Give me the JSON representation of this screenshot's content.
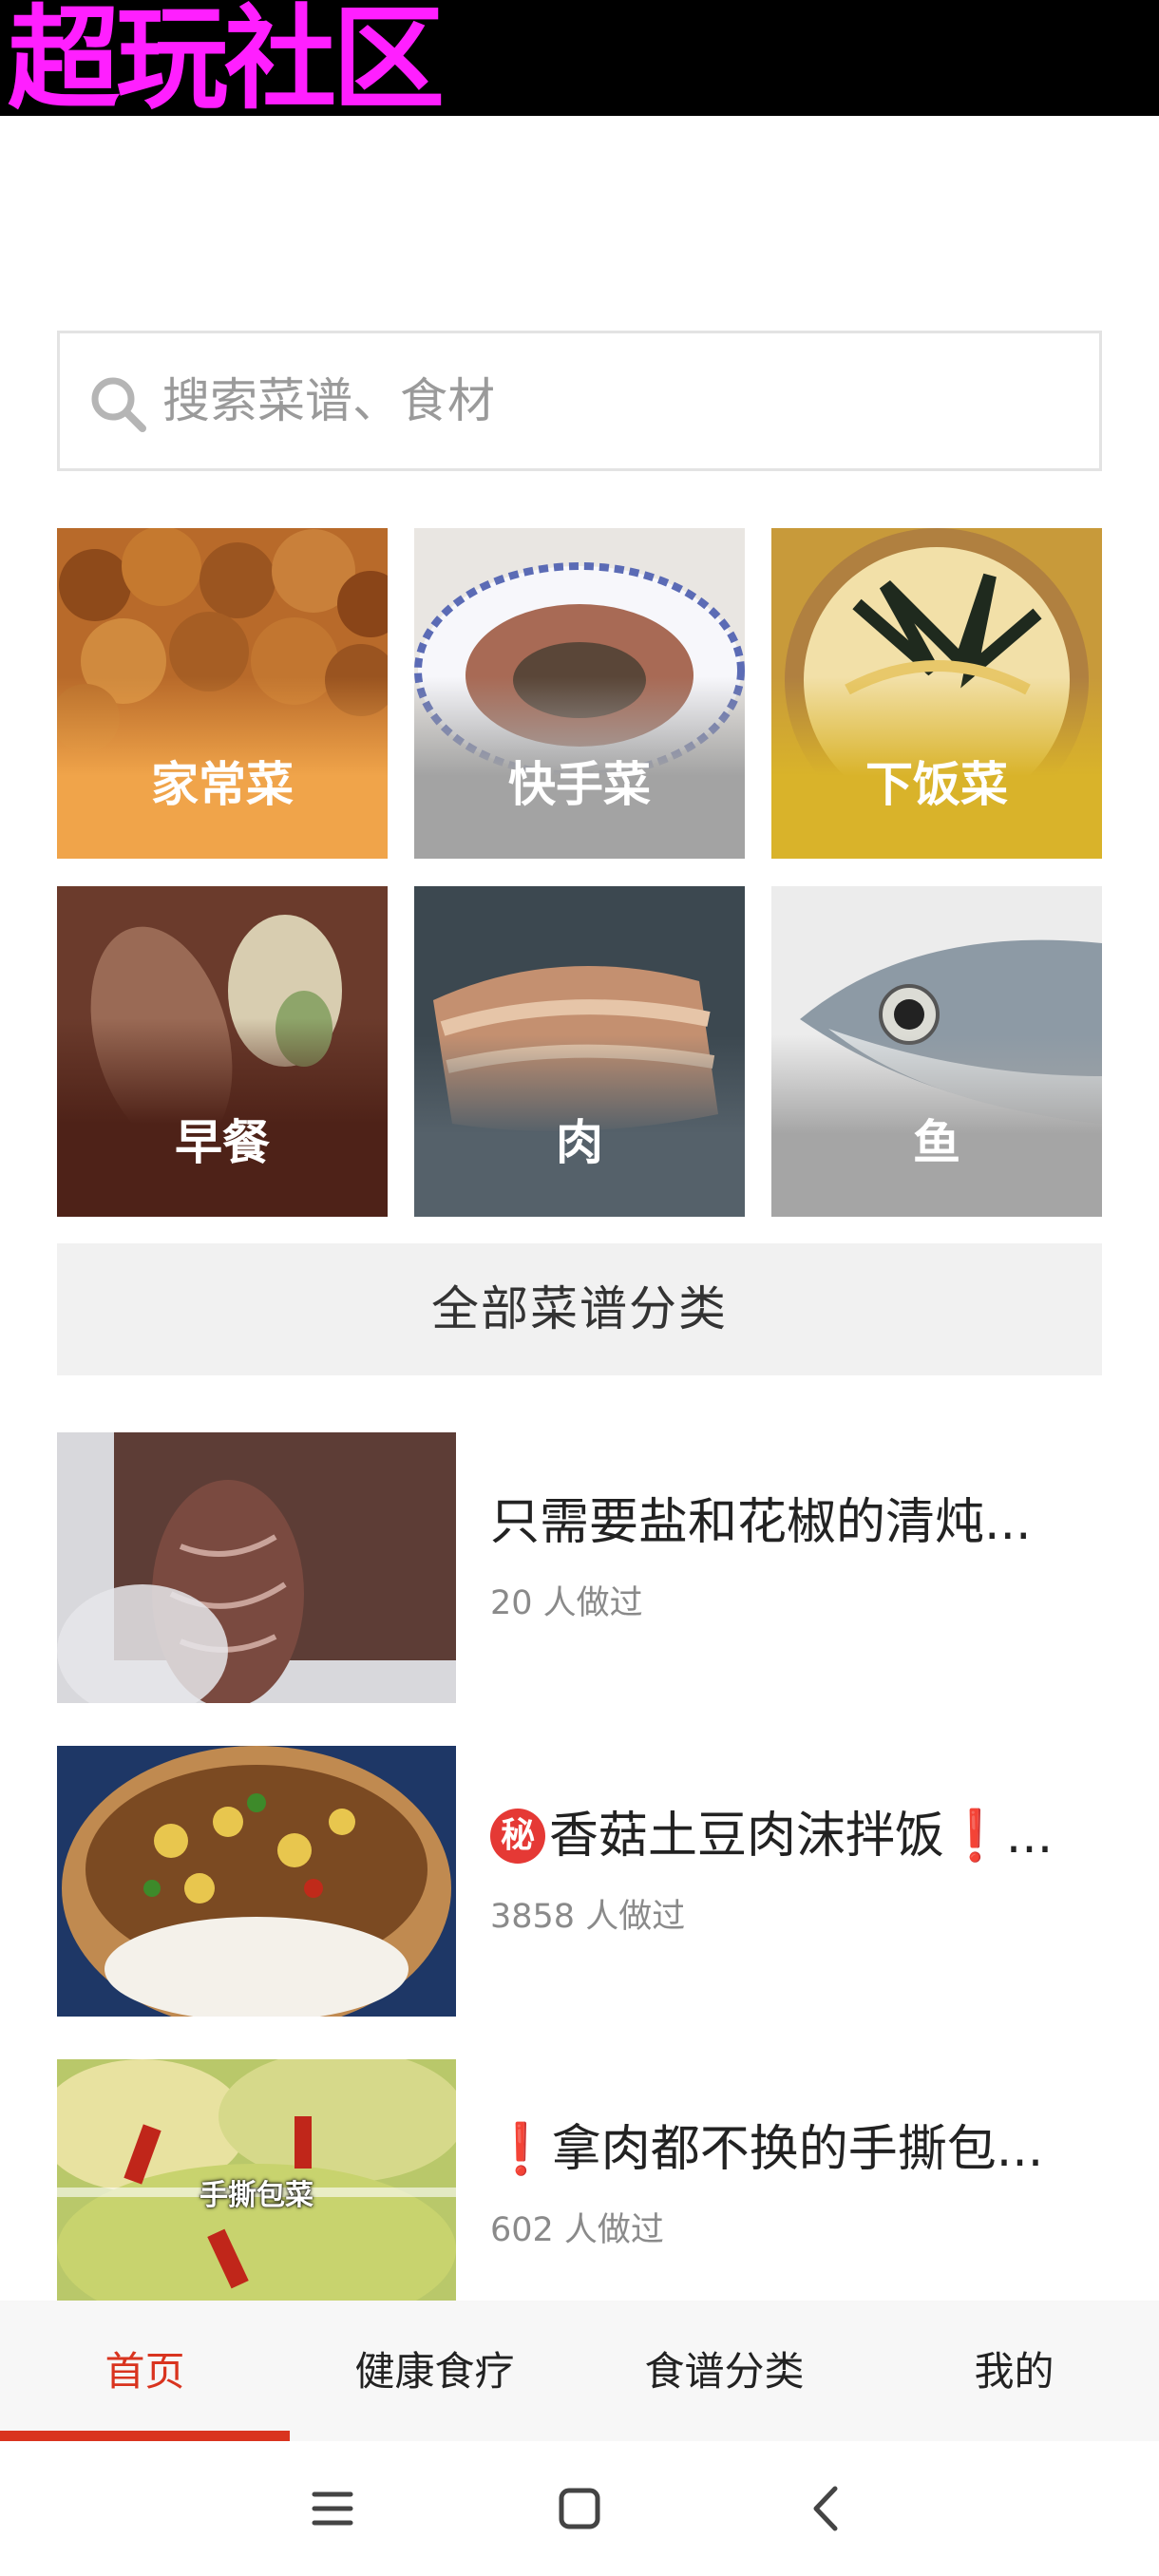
{
  "watermark": "超玩社区",
  "search": {
    "placeholder": "搜索菜谱、食材"
  },
  "categories": [
    {
      "label": "家常菜",
      "color": "#f0a44a"
    },
    {
      "label": "快手菜",
      "color": "#a3a3a3"
    },
    {
      "label": "下饭菜",
      "color": "#d9b32a"
    },
    {
      "label": "早餐",
      "color": "#4e2218"
    },
    {
      "label": "肉",
      "color": "#55616a"
    },
    {
      "label": "鱼",
      "color": "#a5a5a5"
    }
  ],
  "all_categories_label": "全部菜谱分类",
  "recipes": [
    {
      "prefix_badge": "",
      "prefix_mark": "",
      "title": "只需要盐和花椒的清炖...",
      "count": "20 人做过"
    },
    {
      "prefix_badge": "秘",
      "prefix_mark": "",
      "title": "香菇土豆肉沫拌饭❗...",
      "count": "3858 人做过"
    },
    {
      "prefix_badge": "",
      "prefix_mark": "❗",
      "title": "拿肉都不换的手撕包...",
      "count": "602 人做过",
      "thumb_caption": "手撕包菜"
    }
  ],
  "tabs": [
    {
      "label": "首页",
      "active": true
    },
    {
      "label": "健康食疗",
      "active": false
    },
    {
      "label": "食谱分类",
      "active": false
    },
    {
      "label": "我的",
      "active": false
    }
  ],
  "colors": {
    "accent": "#d9341f",
    "watermark": "#ff1fff"
  },
  "system_nav": {
    "icons": [
      "menu-icon",
      "home-icon",
      "back-icon"
    ]
  }
}
